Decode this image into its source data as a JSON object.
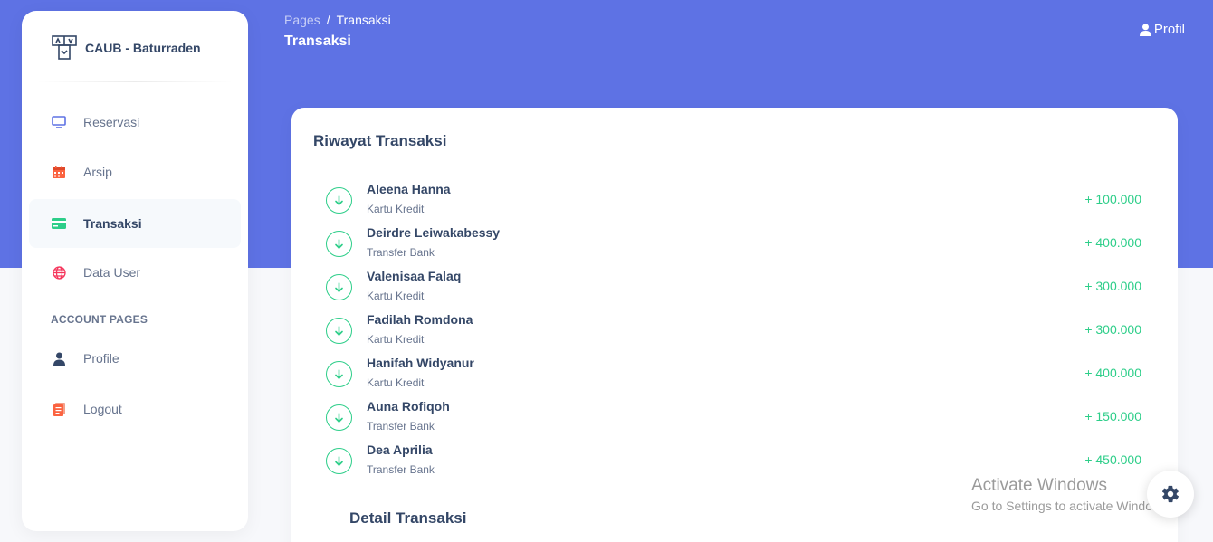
{
  "brand": {
    "name": "CAUB - Baturraden",
    "logo_icon": "building-logo-icon"
  },
  "sidebar": {
    "items": [
      {
        "label": "Reservasi",
        "icon": "monitor-icon",
        "color": "#5e72e4",
        "active": false
      },
      {
        "label": "Arsip",
        "icon": "calendar-icon",
        "color": "#fb6340",
        "active": false
      },
      {
        "label": "Transaksi",
        "icon": "credit-card-icon",
        "color": "#2dce89",
        "active": true
      },
      {
        "label": "Data User",
        "icon": "globe-icon",
        "color": "#f5365c",
        "active": false
      }
    ],
    "section_heading": "ACCOUNT PAGES",
    "account_items": [
      {
        "label": "Profile",
        "icon": "user-icon",
        "color": "#344767"
      },
      {
        "label": "Logout",
        "icon": "document-icon",
        "color": "#fb6340"
      }
    ]
  },
  "header": {
    "breadcrumb_root": "Pages",
    "breadcrumb_separator": "/",
    "breadcrumb_current": "Transaksi",
    "title": "Transaksi",
    "profile_label": "Profil"
  },
  "card": {
    "title": "Riwayat Transaksi",
    "transactions": [
      {
        "name": "Aleena Hanna",
        "method": "Kartu Kredit",
        "amount": "+ 100.000"
      },
      {
        "name": "Deirdre Leiwakabessy",
        "method": "Transfer Bank",
        "amount": "+ 400.000"
      },
      {
        "name": "Valenisaa Falaq",
        "method": "Kartu Kredit",
        "amount": "+ 300.000"
      },
      {
        "name": "Fadilah Romdona",
        "method": "Kartu Kredit",
        "amount": "+ 300.000"
      },
      {
        "name": "Hanifah Widyanur",
        "method": "Kartu Kredit",
        "amount": "+ 400.000"
      },
      {
        "name": "Auna Rofiqoh",
        "method": "Transfer Bank",
        "amount": "+ 150.000"
      },
      {
        "name": "Dea Aprilia",
        "method": "Transfer Bank",
        "amount": "+ 450.000"
      }
    ],
    "detail_title": "Detail Transaksi"
  },
  "watermark": {
    "title": "Activate Windows",
    "subtitle": "Go to Settings to activate Windows."
  },
  "colors": {
    "primary": "#5e72e4",
    "success": "#2dce89",
    "text_dark": "#344767",
    "text_muted": "#67748e"
  }
}
